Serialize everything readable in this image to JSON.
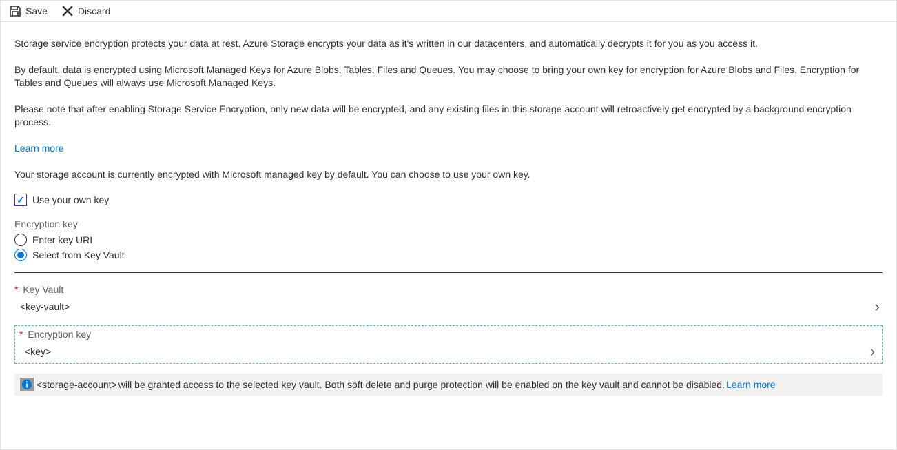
{
  "toolbar": {
    "save_label": "Save",
    "discard_label": "Discard"
  },
  "intro": {
    "p1": "Storage service encryption protects your data at rest. Azure Storage encrypts your data as it's written in our datacenters, and automatically decrypts it for you as you access it.",
    "p2": "By default, data is encrypted using Microsoft Managed Keys for Azure Blobs, Tables, Files and Queues. You may choose to bring your own key for encryption for Azure Blobs and Files. Encryption for Tables and Queues will always use Microsoft Managed Keys.",
    "p3": "Please note that after enabling Storage Service Encryption, only new data will be encrypted, and any existing files in this storage account will retroactively get encrypted by a background encryption process.",
    "learn_more": "Learn more",
    "status": "Your storage account is currently encrypted with Microsoft managed key by default. You can choose to use your own key."
  },
  "own_key": {
    "checkbox_label": "Use your own key",
    "checked": true
  },
  "key_mode": {
    "label": "Encryption key",
    "option_uri": "Enter key URI",
    "option_vault": "Select from Key Vault"
  },
  "fields": {
    "keyvault_label": "Key Vault",
    "keyvault_value": "<key-vault>",
    "enckey_label": "Encryption key",
    "enckey_value": "<key>"
  },
  "info": {
    "prefix": "<storage-account>",
    "text": " will be granted access to the selected key vault. Both soft delete and purge protection will be enabled on the key vault and cannot be disabled. ",
    "learn_more": "Learn more"
  }
}
